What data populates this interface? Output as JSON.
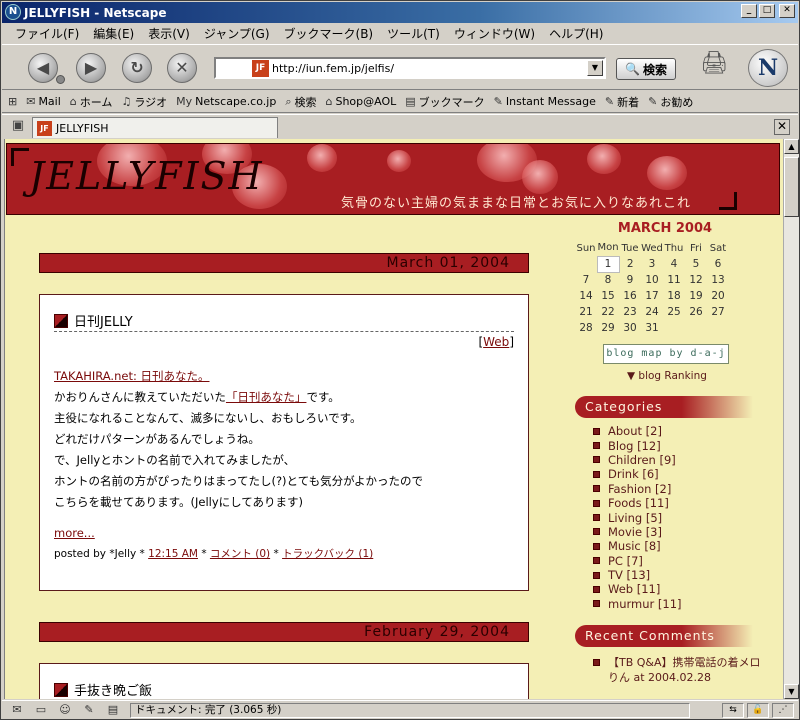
{
  "window": {
    "title": "JELLYFISH - Netscape",
    "minimize": "_",
    "maximize": "□",
    "close": "✕"
  },
  "menu": [
    "ファイル(F)",
    "編集(E)",
    "表示(V)",
    "ジャンプ(G)",
    "ブックマーク(B)",
    "ツール(T)",
    "ウィンドウ(W)",
    "ヘルプ(H)"
  ],
  "nav": {
    "url": "http://iun.fem.jp/jelfis/",
    "search_label": "検索"
  },
  "personal_toolbar": [
    {
      "icon": "mail-icon",
      "label": "Mail"
    },
    {
      "icon": "home-icon",
      "label": "ホーム"
    },
    {
      "icon": "radio-icon",
      "label": "ラジオ"
    },
    {
      "icon": "my-icon",
      "label": "Netscape.co.jp"
    },
    {
      "icon": "search-icon",
      "label": "検索"
    },
    {
      "icon": "shop-icon",
      "label": "Shop@AOL"
    },
    {
      "icon": "bookmark-icon",
      "label": "ブックマーク"
    },
    {
      "icon": "im-icon",
      "label": "Instant Message"
    },
    {
      "icon": "bookmark-icon",
      "label": "新着"
    },
    {
      "icon": "bookmark-icon",
      "label": "お勧め"
    }
  ],
  "tab": {
    "title": "JELLYFISH"
  },
  "blog": {
    "logo": "JELLYFISH",
    "tagline": "気骨のない主婦の気ままな日常とお気に入りなあれこれ",
    "posts": [
      {
        "date": "March 01, 2004",
        "title": "日刊JELLY",
        "webtag": "Web",
        "link": "TAKAHIRA.net: 日刊あなた。",
        "lines": [
          "かおりんさんに教えていただいた",
          "主役になれることなんて、滅多にないし、おもしろいです。",
          "どれだけパターンがあるんでしょうね。",
          "で、Jellyとホントの名前で入れてみましたが、",
          "ホントの名前の方がぴったりはまってたし(?)とても気分がよかったので",
          "こちらを載せてあります。(Jellyにしてあります)"
        ],
        "line1_link": "「日刊あなた」",
        "line1_tail": "です。",
        "more": "more...",
        "footer_prefix": "posted by *Jelly * ",
        "time": "12:15 AM",
        "comments": "コメント (0)",
        "trackback": "トラックバック (1)"
      },
      {
        "date": "February 29, 2004",
        "title": "手抜き晩ご飯"
      }
    ]
  },
  "sidebar": {
    "calendar_title": "MARCH 2004",
    "weekdays": [
      "Sun",
      "Mon",
      "Tue",
      "Wed",
      "Thu",
      "Fri",
      "Sat"
    ],
    "weeks": [
      [
        "",
        "1",
        "2",
        "3",
        "4",
        "5",
        "6"
      ],
      [
        "7",
        "8",
        "9",
        "10",
        "11",
        "12",
        "13"
      ],
      [
        "14",
        "15",
        "16",
        "17",
        "18",
        "19",
        "20"
      ],
      [
        "21",
        "22",
        "23",
        "24",
        "25",
        "26",
        "27"
      ],
      [
        "28",
        "29",
        "30",
        "31",
        "",
        "",
        ""
      ]
    ],
    "today": "1",
    "blogmap": "blog map by d-a-j",
    "ranking": "▼ blog Ranking",
    "categories_title": "Categories",
    "categories": [
      "About [2]",
      "Blog [12]",
      "Children [9]",
      "Drink [6]",
      "Fashion [2]",
      "Foods [11]",
      "Living [5]",
      "Movie [3]",
      "Music [8]",
      "PC [7]",
      "TV [13]",
      "Web [11]",
      "murmur [11]"
    ],
    "recent_title": "Recent Comments",
    "recent_line1": "【TB Q&A】携帯電話の着メロ",
    "recent_line2": "りん at 2004.02.28"
  },
  "status": {
    "text": "ドキュメント: 完了 (3.065 秒)"
  }
}
